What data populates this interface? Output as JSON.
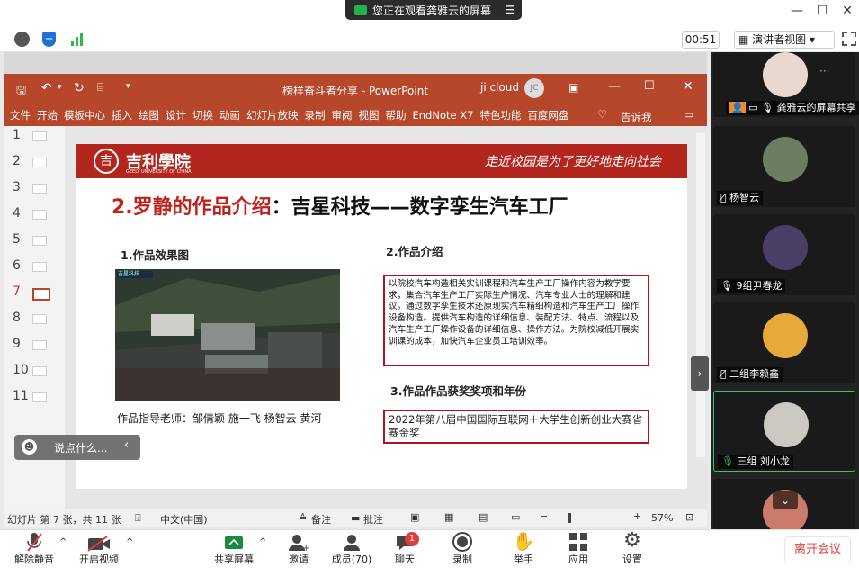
{
  "top": {
    "share_status": "您正在观看龚雅云的屏幕",
    "minimize": "—",
    "maximize": "☐",
    "close": "✕"
  },
  "toolbar": {
    "timer": "00:51",
    "view_mode": "演讲者视图",
    "view_chevron": "▾"
  },
  "ppt": {
    "title": "榜样奋斗者分享 - PowerPoint",
    "user": "ji cloud",
    "user_initials": "JC",
    "ribbon": [
      "文件",
      "开始",
      "模板中心",
      "插入",
      "绘图",
      "设计",
      "切换",
      "动画",
      "幻灯片放映",
      "录制",
      "审阅",
      "视图",
      "帮助",
      "EndNote X7",
      "特色功能",
      "百度网盘"
    ],
    "tell_me": "告诉我",
    "thumb_numbers": [
      "1",
      "2",
      "3",
      "4",
      "5",
      "6",
      "7",
      "8",
      "9",
      "10",
      "11"
    ],
    "active_slide": 7,
    "status_slide": "幻灯片 第 7 张，共 11 张",
    "status_lang": "中文(中国)",
    "status_notes": "备注",
    "status_comments": "批注",
    "zoom": "57%"
  },
  "slide": {
    "school_logo": "吉利學院",
    "school_en": "GEELY UNIVERSITY OF CHINA",
    "slogan": "走近校园是为了更好地走向社会",
    "heading_red": "2.罗静的作品介绍",
    "heading_black": "：吉星科技——数字孪生汽车工厂",
    "sec1": "1.作品效果图",
    "sec2": "2.作品介绍",
    "sec3": "3.作品作品获奖奖项和年份",
    "photo_label": "吉星科技",
    "teacher": "作品指导老师：邹倩颖 施一飞 杨智云 黄河",
    "intro": "以院校汽车构造相关实训课程和汽车生产工厂操作内容为教学要求，集合汽车生产工厂实际生产情况、汽车专业人士的理解和建议。通过数字孪生技术还原现实汽车精细构造和汽车生产工厂操作设备构造。提供汽车构造的详细信息、装配方法、特点、流程以及汽车生产工厂操作设备的详细信息、操作方法。为院校减低开展实训课的成本，加快汽车企业员工培训效率。",
    "award": "2022年第八届中国国际互联网＋大学生创新创业大赛省赛金奖"
  },
  "chat": {
    "placeholder": "说点什么..."
  },
  "participants": [
    {
      "name": "龚雅云的屏幕共享"
    },
    {
      "name": "杨智云"
    },
    {
      "name": "9组尹春龙"
    },
    {
      "name": "二组李赖鑫"
    },
    {
      "name": "三组 刘小龙"
    }
  ],
  "bottom": {
    "mute": "解除静音",
    "video": "开启视频",
    "share": "共享屏幕",
    "invite": "邀请",
    "members": "成员(70)",
    "chat": "聊天",
    "chat_badge": "1",
    "record": "录制",
    "raise": "举手",
    "apps": "应用",
    "settings": "设置",
    "leave": "离开会议"
  }
}
